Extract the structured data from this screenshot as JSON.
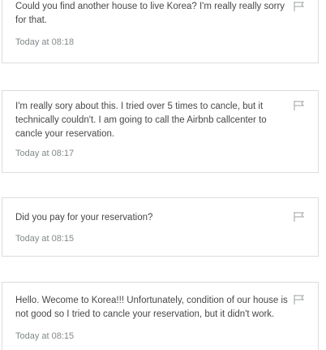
{
  "messages": [
    {
      "text": "Could you find another house to live Korea? I'm really really sorry for that.",
      "time": "Today at 08:18",
      "icon": "flag-icon"
    },
    {
      "text": "I'm really sory about this. I tried over 5 times to cancle, but it technically couldn't. I am going to call the Airbnb callcenter to cancle your reservation.",
      "time": "Today at 08:17",
      "icon": "flag-icon"
    },
    {
      "text": "Did you pay for your reservation?",
      "time": "Today at 08:15",
      "icon": "flag-icon"
    },
    {
      "text": "Hello. Wecome to Korea!!! Unfortunately, condition of our house is not good so I tried to cancle your reservation, but it didn't work.",
      "time": "Today at 08:15",
      "icon": "flag-icon"
    }
  ],
  "colors": {
    "text": "#484848",
    "timestamp": "#82888a",
    "border": "#dcdcdc",
    "flag": "#9ba0a3"
  }
}
